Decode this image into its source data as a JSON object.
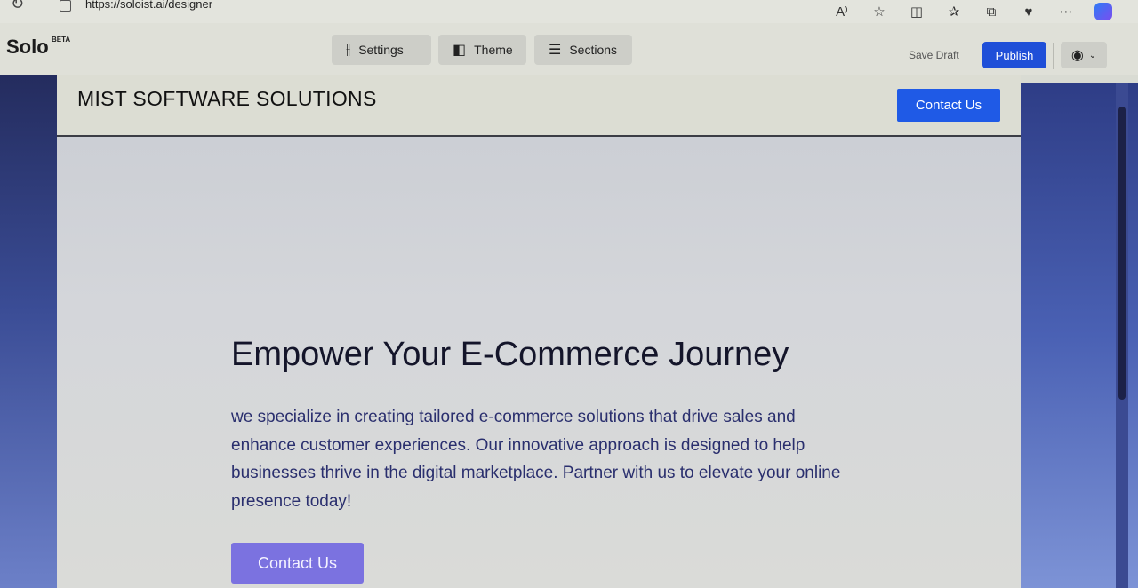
{
  "browser": {
    "url": "https://soloist.ai/designer",
    "icons": [
      "read-aloud-icon",
      "favorite-icon",
      "split-screen-icon",
      "favorites-list-icon",
      "collections-icon",
      "health-icon",
      "extensions-icon",
      "copilot-icon"
    ]
  },
  "app": {
    "logo": "Solo",
    "badge": "BETA",
    "tabs": [
      {
        "label": "Settings",
        "icon": "sliders-icon"
      },
      {
        "label": "Theme",
        "icon": "palette-icon"
      },
      {
        "label": "Sections",
        "icon": "sections-icon"
      }
    ],
    "save_draft": "Save Draft",
    "publish": "Publish"
  },
  "site": {
    "title": "MIST SOFTWARE SOLUTIONS",
    "header_cta": "Contact Us",
    "hero": {
      "headline": "Empower Your E-Commerce Journey",
      "body": "we specialize in creating tailored e-commerce solutions that drive sales and enhance customer experiences. Our innovative approach is designed to help businesses thrive in the digital marketplace. Partner with us to elevate your online presence today!",
      "cta": "Contact Us"
    }
  },
  "colors": {
    "publish": "#1f4fd8",
    "header_cta": "#1f5ae6",
    "hero_cta": "#7b72e0",
    "hero_text": "#2a2f6e"
  }
}
